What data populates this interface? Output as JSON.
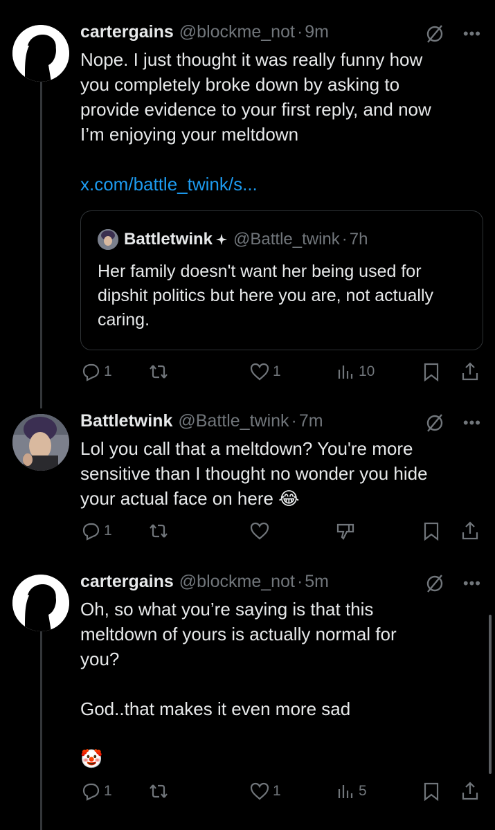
{
  "posts": [
    {
      "name": "cartergains",
      "handle": "@blockme_not",
      "sep": "·",
      "time": "9m",
      "text": "Nope. I just thought it was really funny how\nyou completely broke down by asking to\nprovide evidence to your first reply, and now\nI’m enjoying your meltdown",
      "link": "x.com/battle_twink/s...",
      "quote": {
        "name": "Battletwink",
        "handle": "@Battle_twink",
        "sep": "·",
        "time": "7h",
        "text": "Her family doesn't want her being used for dipshit politics but here you are, not actually caring."
      },
      "actions": {
        "replies": "1",
        "reposts": "",
        "likes": "1",
        "views": "10"
      }
    },
    {
      "name": "Battletwink",
      "handle": "@Battle_twink",
      "sep": "·",
      "time": "7m",
      "text": "Lol you call that a meltdown? You're more\nsensitive than I thought no wonder you hide\nyour actual face on here 😂",
      "actions": {
        "replies": "1",
        "reposts": "",
        "likes": ""
      }
    },
    {
      "name": "cartergains",
      "handle": "@blockme_not",
      "sep": "·",
      "time": "5m",
      "text": "Oh, so what you’re saying is that this\nmeltdown of yours is actually normal for\nyou?\n\nGod..that makes it even more sad\n\n🤡",
      "actions": {
        "replies": "1",
        "reposts": "",
        "likes": "1",
        "views": "5"
      }
    }
  ],
  "icons": {
    "reply": "reply-icon",
    "repost": "repost-icon",
    "like": "heart-icon",
    "views": "views-icon",
    "bookmark": "bookmark-icon",
    "share": "share-icon",
    "grok": "grok-icon",
    "more": "more-icon",
    "sparkle": "sparkle-icon"
  },
  "colors": {
    "background": "#000000",
    "text": "#e7e9ea",
    "muted": "#71767b",
    "link": "#1d9bf0",
    "border": "#2f3336"
  }
}
